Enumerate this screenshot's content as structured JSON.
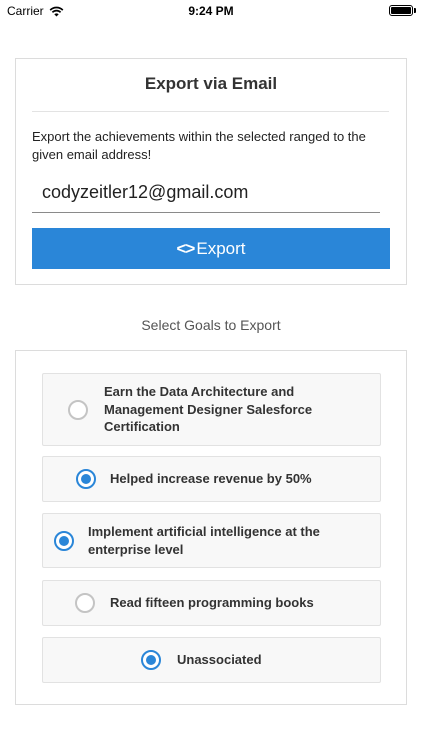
{
  "status_bar": {
    "carrier": "Carrier",
    "time": "9:24 PM",
    "icons": [
      "wifi-icon",
      "battery-icon"
    ]
  },
  "export": {
    "title": "Export via Email",
    "description": "Export the achievements within the selected ranged to the given email address!",
    "email_value": "codyzeitler12@gmail.com",
    "button_icon": "code-icon",
    "button_label": "Export"
  },
  "goals_section_label": "Select Goals to Export",
  "goals": [
    {
      "label": "Earn the Data Architecture and Management Designer Salesforce Certification",
      "selected": false
    },
    {
      "label": "Helped increase revenue by 50%",
      "selected": true
    },
    {
      "label": "Implement artificial intelligence at the enterprise level",
      "selected": true
    },
    {
      "label": "Read fifteen programming books",
      "selected": false
    },
    {
      "label": "Unassociated",
      "selected": true
    }
  ],
  "colors": {
    "accent": "#2a86d8",
    "radio_unselected": "#c4c4c4",
    "card_border": "#dcdcdc",
    "goal_background": "#f8f8f8"
  }
}
